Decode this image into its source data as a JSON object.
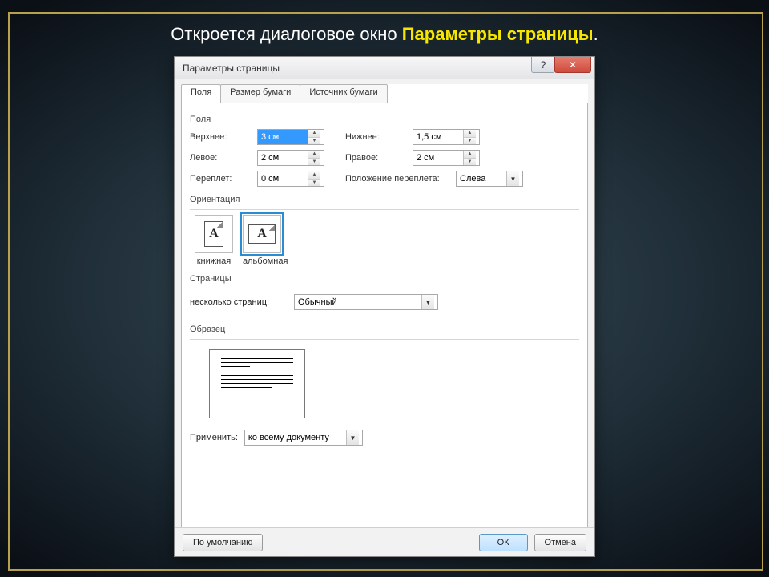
{
  "slide": {
    "caption_plain": "Откроется диалоговое окно ",
    "caption_highlight": "Параметры страницы",
    "caption_period": "."
  },
  "dialog": {
    "title": "Параметры страницы",
    "help_glyph": "?",
    "close_glyph": "✕",
    "tabs": {
      "fields": "Поля",
      "paper_size": "Размер бумаги",
      "paper_source": "Источник бумаги"
    },
    "margins_section": "Поля",
    "top_label": "Верхнее:",
    "bottom_label": "Нижнее:",
    "left_label": "Левое:",
    "right_label": "Правое:",
    "gutter_label": "Переплет:",
    "gutter_pos_label": "Положение переплета:",
    "values": {
      "top": "3 см",
      "bottom": "1,5 см",
      "left": "2 см",
      "right": "2 см",
      "gutter": "0 см",
      "gutter_pos": "Слева"
    },
    "orientation_section": "Ориентация",
    "orientation": {
      "portrait": "книжная",
      "landscape": "альбомная",
      "glyph": "A"
    },
    "pages_section": "Страницы",
    "pages_label": "несколько страниц:",
    "pages_value": "Обычный",
    "preview_section": "Образец",
    "apply_label": "Применить:",
    "apply_value": "ко всему документу",
    "footer": {
      "default": "По умолчанию",
      "ok": "ОК",
      "cancel": "Отмена"
    }
  }
}
